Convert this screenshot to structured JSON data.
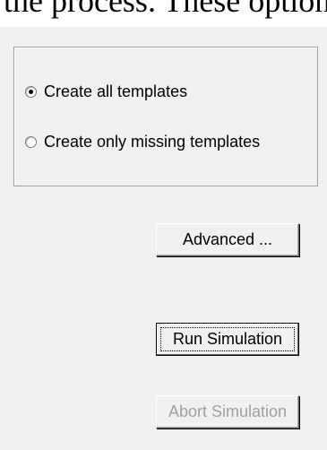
{
  "doc_fragment": {
    "text": "the process.  These options"
  },
  "radio_group": {
    "options": [
      {
        "label": "Create all templates",
        "checked": true
      },
      {
        "label": "Create only missing templates",
        "checked": false
      }
    ]
  },
  "buttons": {
    "advanced": "Advanced ...",
    "run": "Run Simulation",
    "abort": "Abort Simulation"
  },
  "colors": {
    "background": "#f0f0f0",
    "disabled_text": "#a0a0a0",
    "group_border": "#a0a0a0"
  }
}
